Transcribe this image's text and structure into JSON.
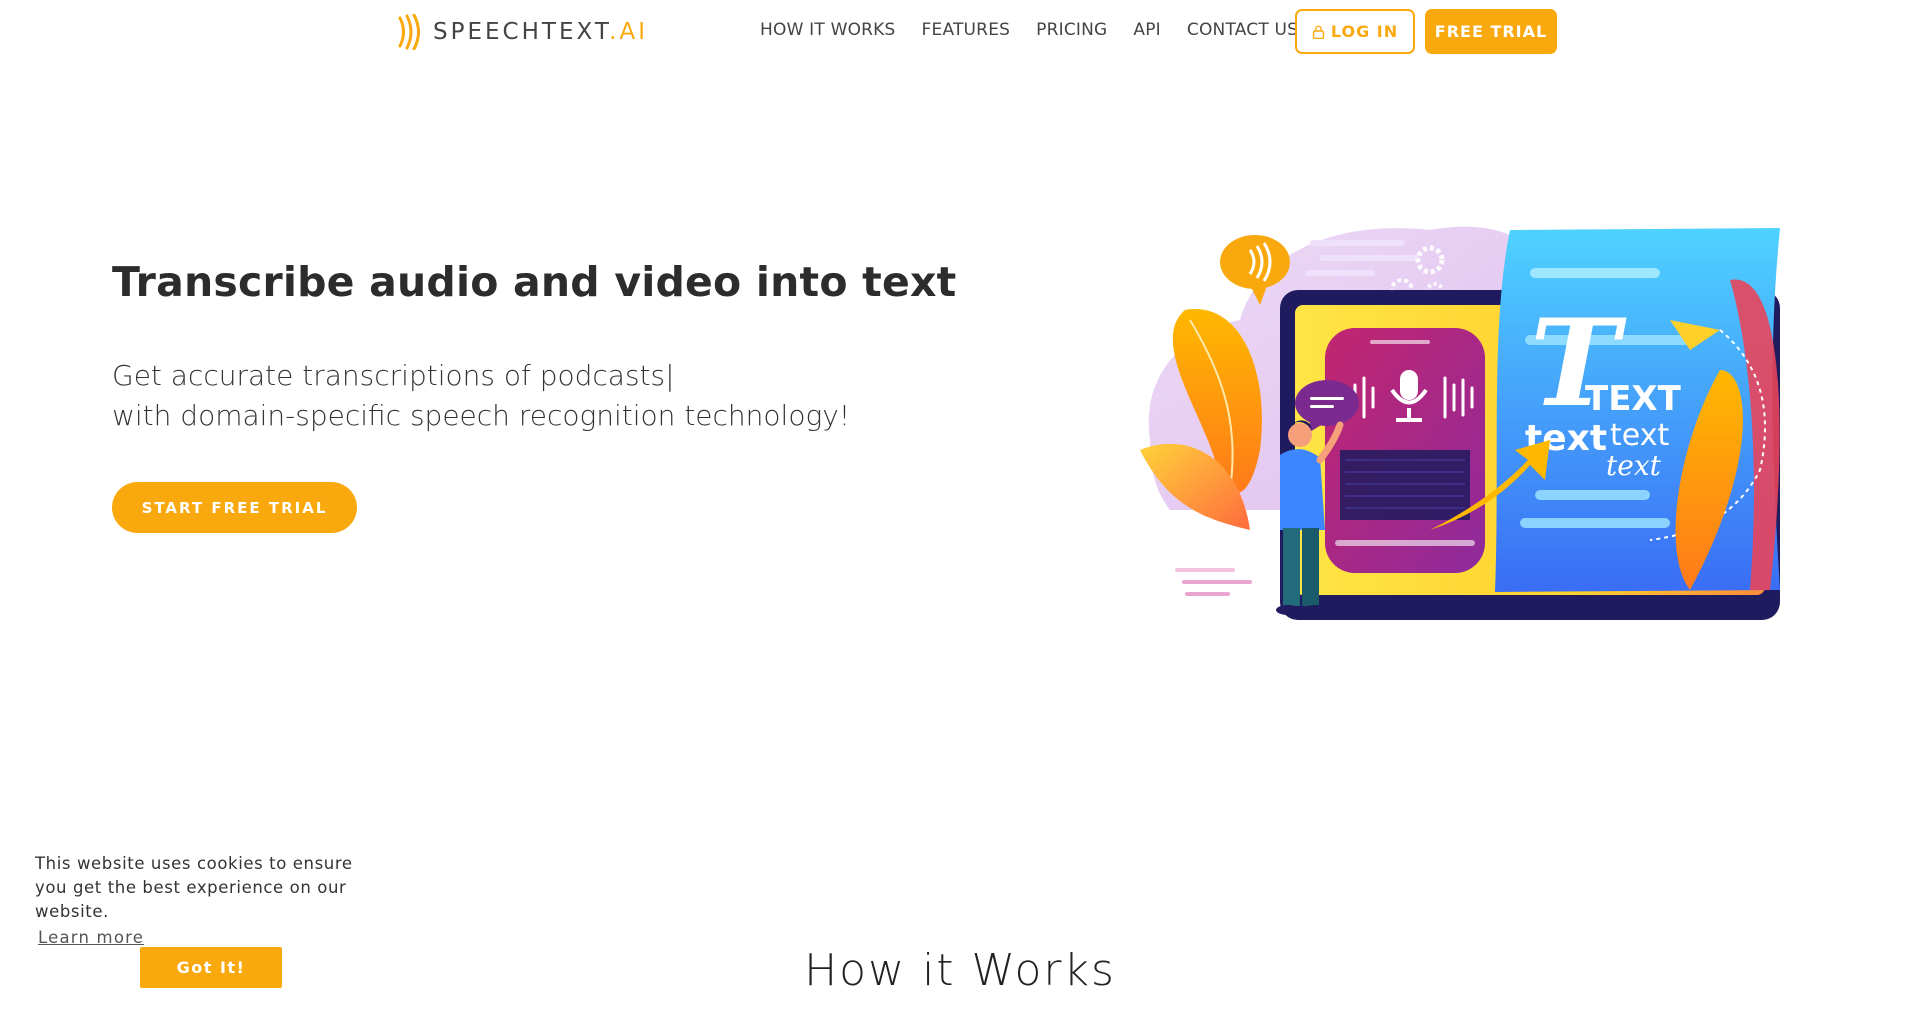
{
  "header": {
    "logo_main": "SPEECHTEXT",
    "logo_accent": ".AI",
    "nav": [
      "HOW IT WORKS",
      "FEATURES",
      "PRICING",
      "API",
      "CONTACT US"
    ],
    "login_label": "LOG IN",
    "trial_label": "FREE TRIAL"
  },
  "hero": {
    "title": "Transcribe audio and video into text",
    "subtitle_line1": "Get accurate transcriptions of podcasts|",
    "subtitle_line2": "with domain-specific speech recognition technology!",
    "cta_label": "START FREE TRIAL"
  },
  "illustration": {
    "big_letter": "T",
    "word_caps": "TEXT",
    "word_bold": "text",
    "word_regular": "text",
    "word_italic": "text"
  },
  "cookie": {
    "text": "This website uses cookies to ensure you get the best experience on our website.",
    "link_label": "Learn more",
    "button_label": "Got It!"
  },
  "section": {
    "title": "How it Works"
  },
  "colors": {
    "accent": "#f9a90e",
    "text_dark": "#2c2c2c"
  }
}
